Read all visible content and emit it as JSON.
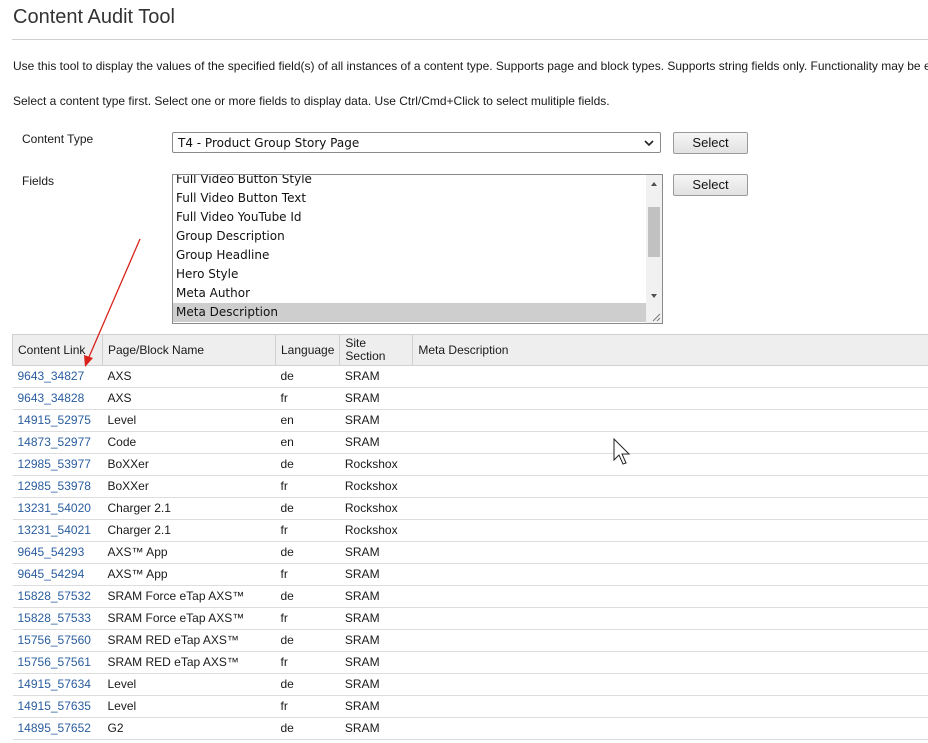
{
  "page": {
    "title": "Content Audit Tool",
    "description": "Use this tool to display the values of the specified field(s) of all instances of a content type. Supports page and block types. Supports string fields only. Functionality may be e",
    "instructions": "Select a content type first. Select one or more fields to display data. Use Ctrl/Cmd+Click to select mulitiple fields."
  },
  "form": {
    "content_type_label": "Content Type",
    "content_type_value": "T4 - Product Group Story Page",
    "fields_label": "Fields",
    "select_button_label": "Select",
    "field_options": [
      {
        "label": "Full Video Button Style",
        "selected": false
      },
      {
        "label": "Full Video Button Text",
        "selected": false
      },
      {
        "label": "Full Video YouTube Id",
        "selected": false
      },
      {
        "label": "Group Description",
        "selected": false
      },
      {
        "label": "Group Headline",
        "selected": false
      },
      {
        "label": "Hero Style",
        "selected": false
      },
      {
        "label": "Meta Author",
        "selected": false
      },
      {
        "label": "Meta Description",
        "selected": true
      }
    ]
  },
  "table": {
    "headers": [
      "Content Link",
      "Page/Block Name",
      "Language",
      "Site Section",
      "Meta Description"
    ],
    "rows": [
      {
        "link": "9643_34827",
        "name": "AXS",
        "language": "de",
        "section": "SRAM",
        "meta": ""
      },
      {
        "link": "9643_34828",
        "name": "AXS",
        "language": "fr",
        "section": "SRAM",
        "meta": ""
      },
      {
        "link": "14915_52975",
        "name": "Level",
        "language": "en",
        "section": "SRAM",
        "meta": ""
      },
      {
        "link": "14873_52977",
        "name": "Code",
        "language": "en",
        "section": "SRAM",
        "meta": ""
      },
      {
        "link": "12985_53977",
        "name": "BoXXer",
        "language": "de",
        "section": "Rockshox",
        "meta": ""
      },
      {
        "link": "12985_53978",
        "name": "BoXXer",
        "language": "fr",
        "section": "Rockshox",
        "meta": ""
      },
      {
        "link": "13231_54020",
        "name": "Charger 2.1",
        "language": "de",
        "section": "Rockshox",
        "meta": ""
      },
      {
        "link": "13231_54021",
        "name": "Charger 2.1",
        "language": "fr",
        "section": "Rockshox",
        "meta": ""
      },
      {
        "link": "9645_54293",
        "name": "AXS™ App",
        "language": "de",
        "section": "SRAM",
        "meta": ""
      },
      {
        "link": "9645_54294",
        "name": "AXS™ App",
        "language": "fr",
        "section": "SRAM",
        "meta": ""
      },
      {
        "link": "15828_57532",
        "name": "SRAM Force eTap AXS™",
        "language": "de",
        "section": "SRAM",
        "meta": ""
      },
      {
        "link": "15828_57533",
        "name": "SRAM Force eTap AXS™",
        "language": "fr",
        "section": "SRAM",
        "meta": ""
      },
      {
        "link": "15756_57560",
        "name": "SRAM RED eTap AXS™",
        "language": "de",
        "section": "SRAM",
        "meta": ""
      },
      {
        "link": "15756_57561",
        "name": "SRAM RED eTap AXS™",
        "language": "fr",
        "section": "SRAM",
        "meta": ""
      },
      {
        "link": "14915_57634",
        "name": "Level",
        "language": "de",
        "section": "SRAM",
        "meta": ""
      },
      {
        "link": "14915_57635",
        "name": "Level",
        "language": "fr",
        "section": "SRAM",
        "meta": ""
      },
      {
        "link": "14895_57652",
        "name": "G2",
        "language": "de",
        "section": "SRAM",
        "meta": ""
      }
    ]
  },
  "colors": {
    "link": "#2a5d9f",
    "annotation_arrow": "#d9221c",
    "header_bg": "#eeeeee",
    "selected_option_bg": "#cecece"
  },
  "icons": {
    "select_dropdown": "chevron-down-icon",
    "scroll_up": "triangle-up-icon",
    "scroll_down": "triangle-down-icon",
    "resize": "resize-grip-icon",
    "annotation": "red-arrow-icon",
    "pointer": "mouse-cursor-icon"
  }
}
